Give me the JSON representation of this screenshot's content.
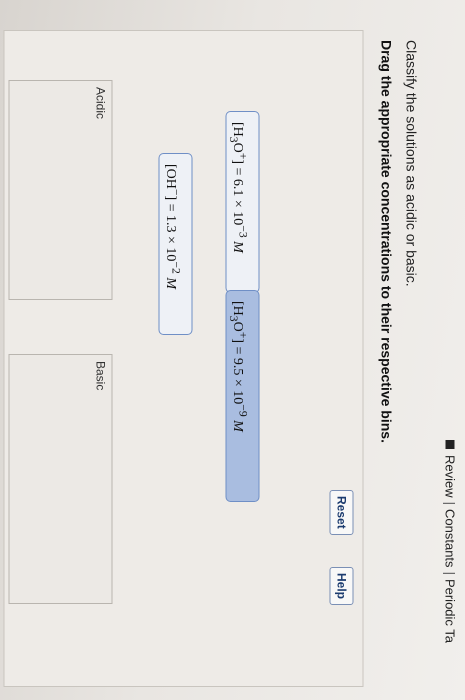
{
  "topbar": {
    "review_label": "Review",
    "separator": "|",
    "constants_label": "Constants",
    "periodic_label": "Periodic Ta"
  },
  "question": {
    "instruction": "Classify the solutions as acidic or basic.",
    "prompt": "Drag the appropriate concentrations to their respective bins."
  },
  "controls": {
    "reset_label": "Reset",
    "help_label": "Help"
  },
  "items": [
    {
      "pre": "[H",
      "sub": "3",
      "mid": "O",
      "sup": "+",
      "post": "] = 6.1 × 10",
      "exp": "−3",
      "unit": " M"
    },
    {
      "pre": "[H",
      "sub": "3",
      "mid": "O",
      "sup": "+",
      "post": "] = 9.5 × 10",
      "exp": "−9",
      "unit": " M"
    },
    {
      "pre": "[OH",
      "sub": "",
      "mid": "",
      "sup": "−",
      "post": "] = 1.3 × 10",
      "exp": "−2",
      "unit": " M"
    }
  ],
  "bins": {
    "acidic_label": "Acidic",
    "basic_label": "Basic"
  },
  "colors": {
    "selected_chip": "#a9bde0",
    "chip_border": "#6f8fc6"
  }
}
